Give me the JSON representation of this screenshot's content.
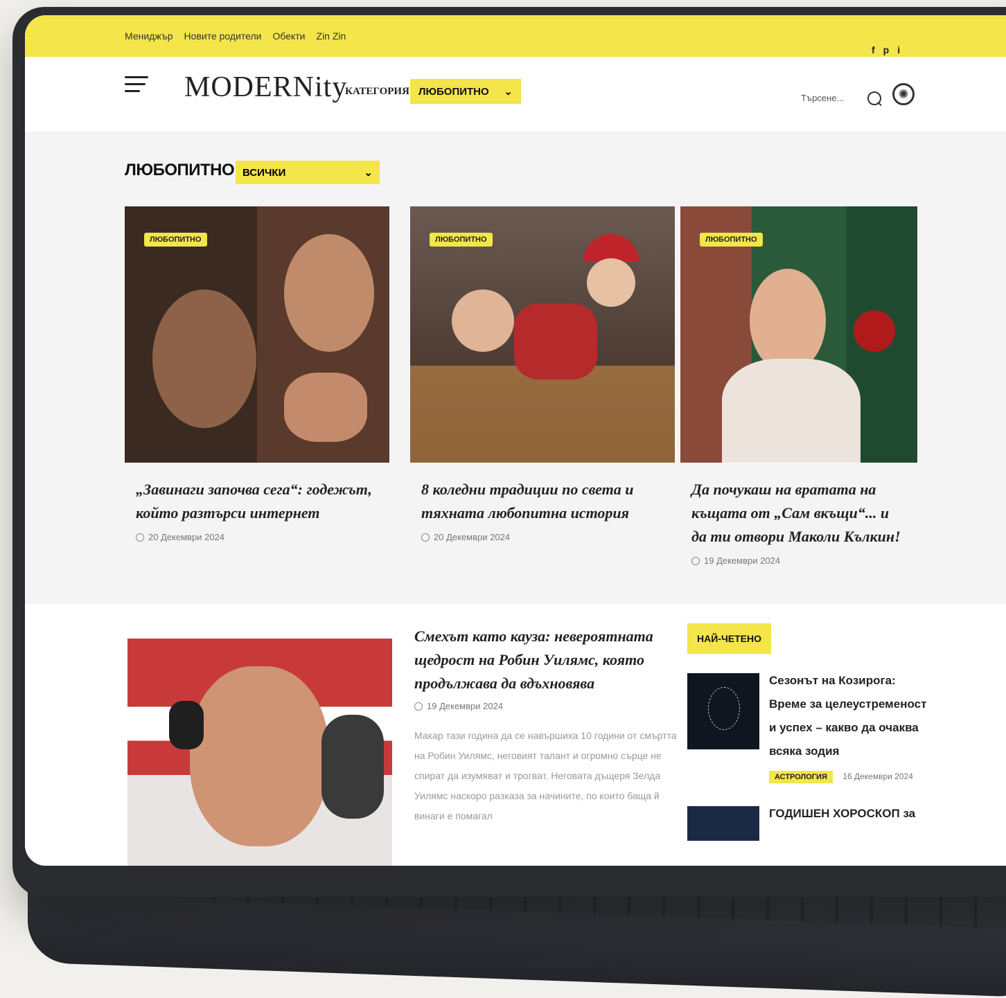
{
  "topbar": {
    "links": [
      "Мениджър",
      "Новите родители",
      "Обекти",
      "Zin Zin"
    ],
    "social": [
      "f",
      "p",
      "i"
    ]
  },
  "header": {
    "logo": "MODERNity",
    "category_label": "КАТЕГОРИЯ:",
    "category_value": "ЛЮБОПИТНО",
    "search_placeholder": "Търсене..."
  },
  "section": {
    "title": "ЛЮБОПИТНО /",
    "filter_value": "ВСИЧКИ"
  },
  "cards": [
    {
      "badge": "ЛЮБОПИТНО",
      "title": "„Завинаги започва сега“: годежът, който разтърси интернет",
      "date": "20 Декември 2024"
    },
    {
      "badge": "ЛЮБОПИТНО",
      "title": "8 коледни традиции по света и тяхната любопитна история",
      "date": "20 Декември 2024"
    },
    {
      "badge": "ЛЮБОПИТНО",
      "title": "Да почукаш на вратата на къщата от „Сам вкъщи“... и да ти отвори Маколи Кълкин!",
      "date": "19 Декември 2024"
    }
  ],
  "featured": {
    "title": "Смехът като кауза: невероятната щедрост на Робин Уилямс, която продължава да вдъхновява",
    "date": "19 Декември 2024",
    "excerpt": "Макар тази година да се навършиха 10 години от смъртта на Робин Уилямс, неговият талант и огромно сърце не спират да изумяват и трогват. Неговата дъщеря Зелда Уилямс наскоро разказа за начините, по които баща й винаги е помагал"
  },
  "most_read": {
    "label": "НАЙ-ЧЕТЕНО",
    "items": [
      {
        "title": "Сезонът на Козирога: Време за целеустременост и успех – какво да очаква всяка зодия",
        "tag": "АСТРОЛОГИЯ",
        "date": "16 Декември 2024"
      },
      {
        "title": "ГОДИШЕН ХОРОСКОП за"
      }
    ]
  },
  "colors": {
    "accent": "#f3e54a",
    "text": "#222222",
    "lid": "#2b2c30"
  }
}
